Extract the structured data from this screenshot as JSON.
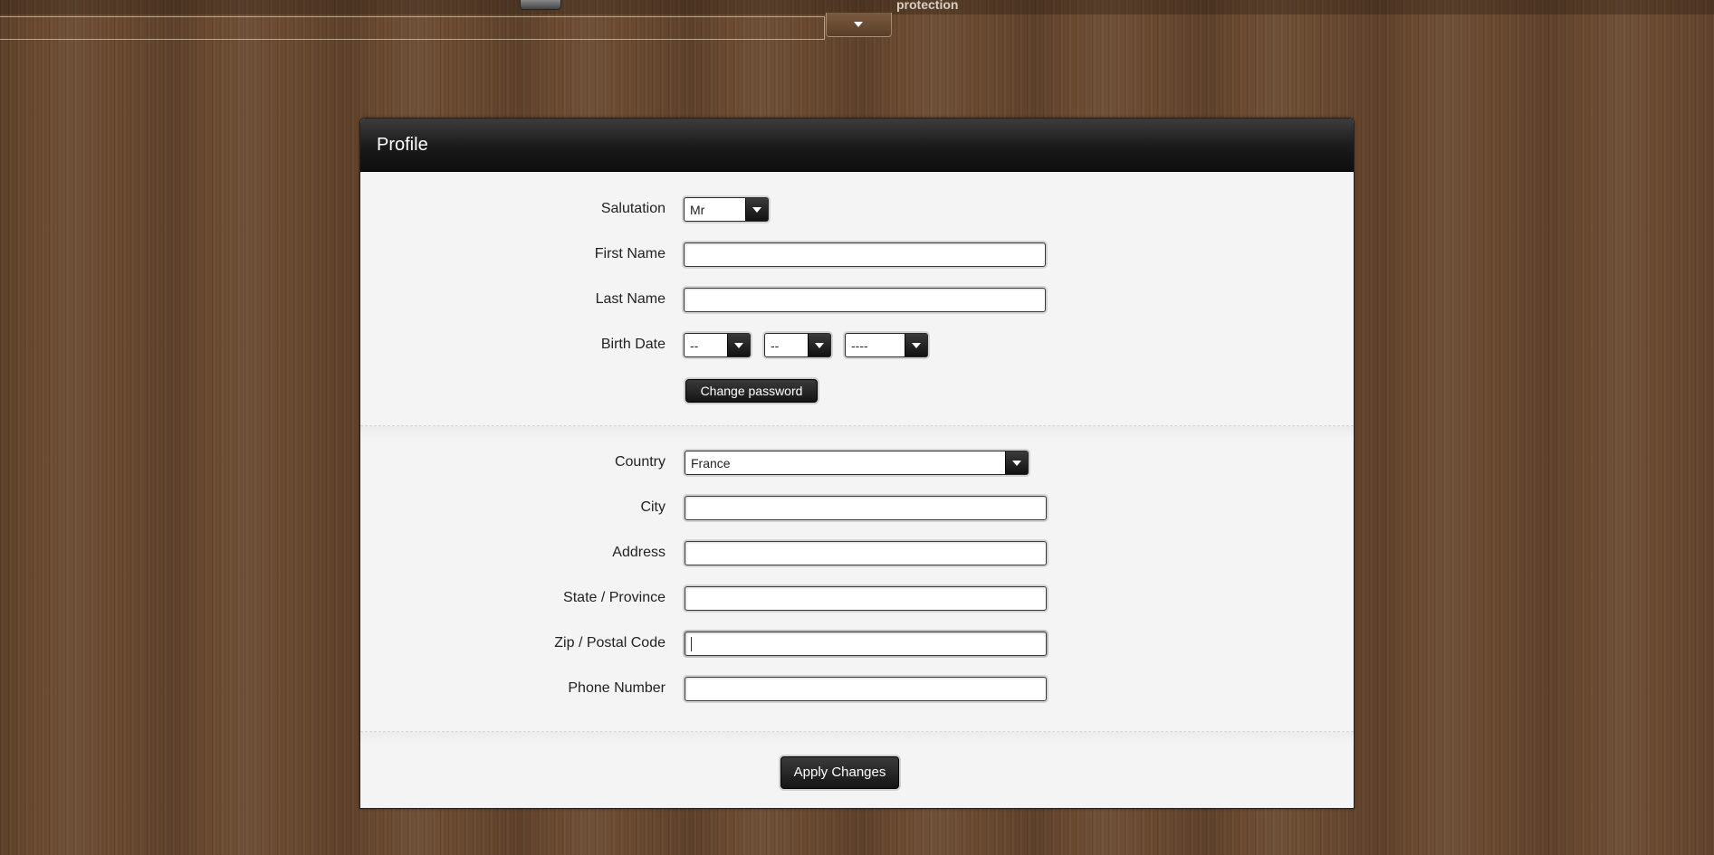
{
  "topbar": {
    "partial_text": "protection"
  },
  "profile": {
    "title": "Profile",
    "personal": {
      "salutation": {
        "label": "Salutation",
        "selected": "Mr"
      },
      "first_name": {
        "label": "First Name",
        "value": ""
      },
      "last_name": {
        "label": "Last Name",
        "value": ""
      },
      "birth_date": {
        "label": "Birth Date",
        "day": "--",
        "month": "--",
        "year": "----"
      },
      "change_password_label": "Change password"
    },
    "address": {
      "country": {
        "label": "Country",
        "selected": "France"
      },
      "city": {
        "label": "City",
        "value": ""
      },
      "address": {
        "label": "Address",
        "value": ""
      },
      "state": {
        "label": "State / Province",
        "value": ""
      },
      "zip": {
        "label": "Zip / Postal Code",
        "value": ""
      },
      "phone": {
        "label": "Phone Number",
        "value": ""
      }
    },
    "apply_label": "Apply Changes"
  }
}
